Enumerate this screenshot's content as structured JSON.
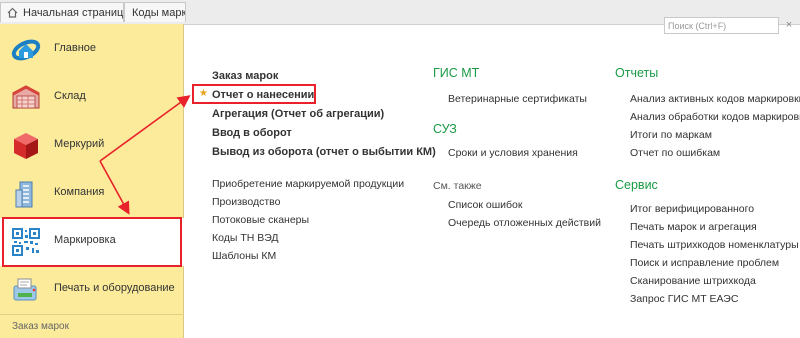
{
  "tabs": {
    "home": "Начальная страница",
    "codes": "Коды маркировки"
  },
  "search": {
    "placeholder": "Поиск (Ctrl+F)",
    "clear_icon": "×"
  },
  "sidebar": {
    "items": [
      {
        "label": "Главное",
        "icon": "home-ring-icon"
      },
      {
        "label": "Склад",
        "icon": "warehouse-icon"
      },
      {
        "label": "Меркурий",
        "icon": "mercury-cube-icon"
      },
      {
        "label": "Компания",
        "icon": "building-icon"
      },
      {
        "label": "Маркировка",
        "icon": "qr-code-icon"
      },
      {
        "label": "Печать и оборудование",
        "icon": "printer-icon"
      }
    ],
    "footer": "Заказ марок",
    "active_index": 4
  },
  "columns": {
    "c1": {
      "items": [
        "Заказ марок",
        "Отчет о нанесении",
        "Агрегация (Отчет об агрегации)",
        "Ввод в оборот",
        "Вывод из оборота (отчет о выбытии КМ)",
        "Приобретение маркируемой продукции",
        "Производство",
        "Потоковые сканеры",
        "Коды ТН ВЭД",
        "Шаблоны КМ"
      ]
    },
    "c2": {
      "groups": [
        {
          "title": "ГИС МТ",
          "items": [
            "Ветеринарные сертификаты"
          ]
        },
        {
          "title": "СУЗ",
          "items": [
            "Сроки и условия хранения"
          ]
        },
        {
          "title": "См. также",
          "items": [
            "Список ошибок",
            "Очередь отложенных действий"
          ]
        }
      ]
    },
    "c3": {
      "groups": [
        {
          "title": "Отчеты",
          "items": [
            "Анализ активных кодов маркировки",
            "Анализ обработки кодов маркировки",
            "Итоги по маркам",
            "Отчет по ошибкам"
          ]
        },
        {
          "title": "Сервис",
          "items": [
            "Итог верифицированного",
            "Печать марок и агрегация",
            "Печать штрихкодов номенклатуры",
            "Поиск и исправление проблем",
            "Сканирование штрихкода",
            "Запрос ГИС МТ ЕАЭС"
          ]
        }
      ]
    }
  },
  "colors": {
    "sidebar_bg": "#fbeb9b",
    "group_title": "#1a9a44",
    "highlight": "#e8212a",
    "star": "#e6a219"
  }
}
